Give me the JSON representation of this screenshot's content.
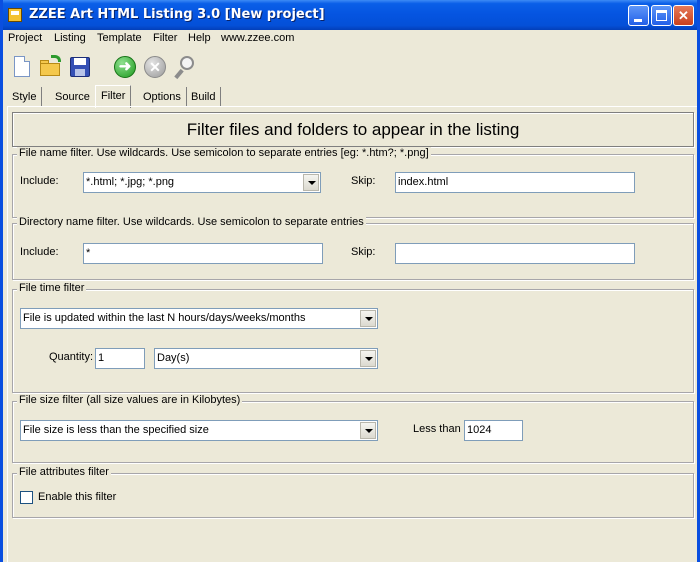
{
  "window": {
    "title": "ZZEE Art HTML Listing 3.0 [New project]"
  },
  "menu": [
    "Project",
    "Listing",
    "Template",
    "Filter",
    "Help",
    "www.zzee.com"
  ],
  "toolbar_icons": [
    "new-document-icon",
    "open-folder-icon",
    "save-disk-icon",
    "go-arrow-icon",
    "stop-icon",
    "magnifier-icon"
  ],
  "tabs": [
    "Style",
    "Source",
    "Filter",
    "Options",
    "Build"
  ],
  "active_tab": "Filter",
  "header": {
    "text": "Filter files and folders to appear in the listing"
  },
  "file_name_filter": {
    "legend": "File name filter. Use wildcards. Use semicolon to separate entries [eg: *.htm?; *.png]",
    "include_label": "Include:",
    "include_value": "*.html; *.jpg; *.png",
    "skip_label": "Skip:",
    "skip_value": "index.html"
  },
  "dir_name_filter": {
    "legend": "Directory name filter. Use wildcards. Use semicolon to separate entries",
    "include_label": "Include:",
    "include_value": "*",
    "skip_label": "Skip:",
    "skip_value": ""
  },
  "file_time_filter": {
    "legend": "File time filter",
    "mode_value": "File is updated within the last N hours/days/weeks/months",
    "quantity_label": "Quantity:",
    "quantity_value": "1",
    "unit_value": "Day(s)"
  },
  "file_size_filter": {
    "legend": "File size filter (all size values are in Kilobytes)",
    "mode_value": "File size is less than the specified size",
    "less_than_label": "Less than",
    "less_than_value": "1024"
  },
  "file_attributes_filter": {
    "legend": "File attributes filter",
    "enable_label": "Enable this filter",
    "enabled": false
  }
}
